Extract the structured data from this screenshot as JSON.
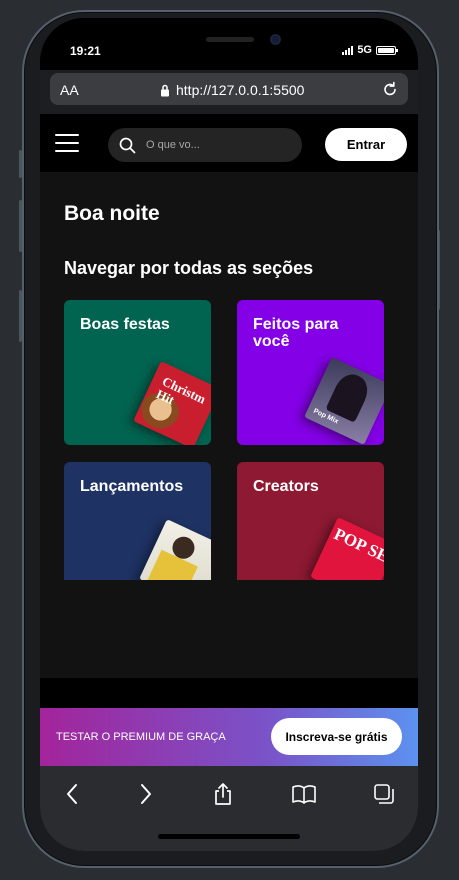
{
  "status": {
    "time": "19:21",
    "network": "5G"
  },
  "browser": {
    "aa_label": "AA",
    "url": "http://127.0.0.1:5500"
  },
  "header": {
    "search_placeholder": "O que vo...",
    "login_label": "Entrar"
  },
  "main": {
    "greeting": "Boa noite",
    "section_title": "Navegar por todas as seções",
    "cards": [
      {
        "label": "Boas festas",
        "color": "#006450",
        "cover_text": "Christm Hit"
      },
      {
        "label": "Feitos para você",
        "color": "#8400e7",
        "cover_text": "Pop Mix"
      },
      {
        "label": "Lançamentos",
        "color": "#1e3264",
        "cover_text": ""
      },
      {
        "label": "Creators",
        "color": "#8d1932",
        "cover_text": "POP SE"
      }
    ]
  },
  "premium_banner": {
    "text": "TESTAR O PREMIUM DE GRAÇA",
    "button_label": "Inscreva-se grátis"
  },
  "icons": [
    "menu-icon",
    "search-icon",
    "lock-icon",
    "reload-icon",
    "back-icon",
    "forward-icon",
    "share-icon",
    "bookmarks-icon",
    "tabs-icon"
  ]
}
